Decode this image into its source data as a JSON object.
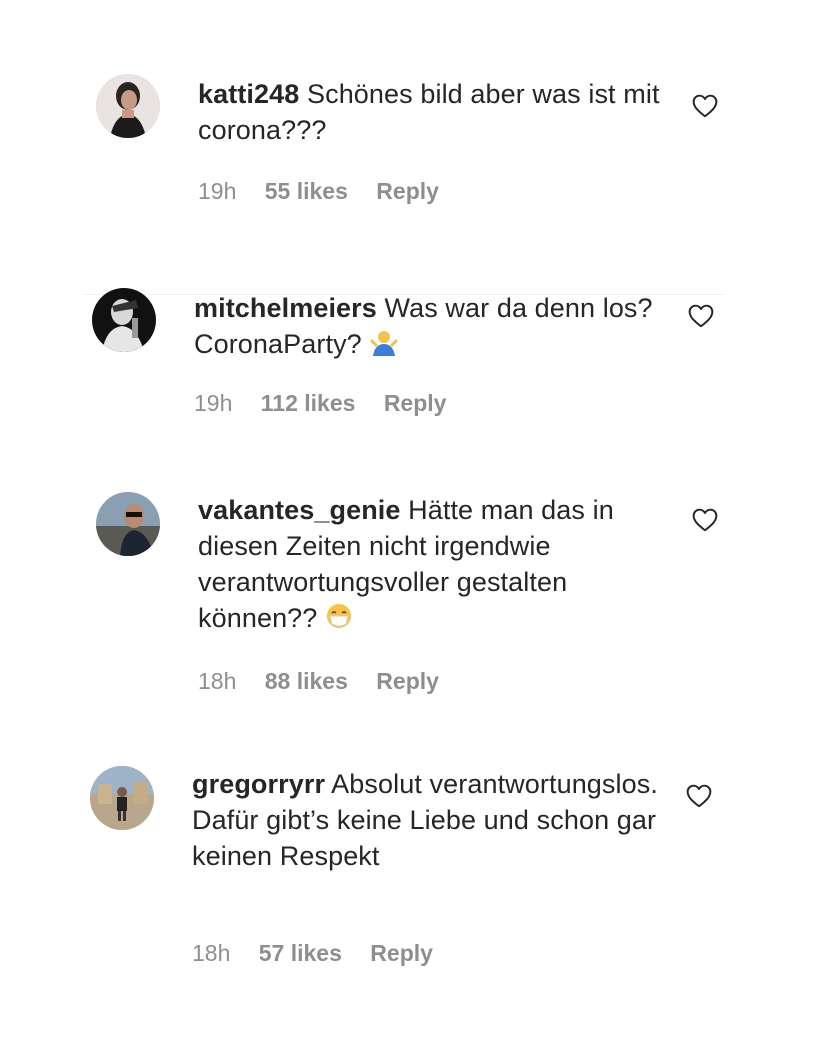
{
  "comments": [
    {
      "username": "katti248",
      "text": "Schönes bild aber was ist mit corona???",
      "time": "19h",
      "likes": "55 likes",
      "reply": "Reply"
    },
    {
      "username": "mitchelmeiers",
      "text": "Was war da denn los? CoronaParty?",
      "emoji": "person-shrugging-emoji",
      "time": "19h",
      "likes": "112 likes",
      "reply": "Reply"
    },
    {
      "username": "vakantes_genie",
      "text": "Hätte man das in diesen Zeiten nicht irgendwie verantwortungsvoller gestalten können??",
      "emoji": "face-with-medical-mask-emoji",
      "time": "18h",
      "likes": "88 likes",
      "reply": "Reply"
    },
    {
      "username": "gregorryrr",
      "text": "Absolut verantwortungslos. Dafür gibt’s keine Liebe und schon gar keinen Respekt",
      "time": "18h",
      "likes": "57 likes",
      "reply": "Reply"
    }
  ],
  "icons": {
    "like": "heart-outline-icon"
  },
  "colors": {
    "text": "#262626",
    "secondary": "#8e8e8e"
  }
}
